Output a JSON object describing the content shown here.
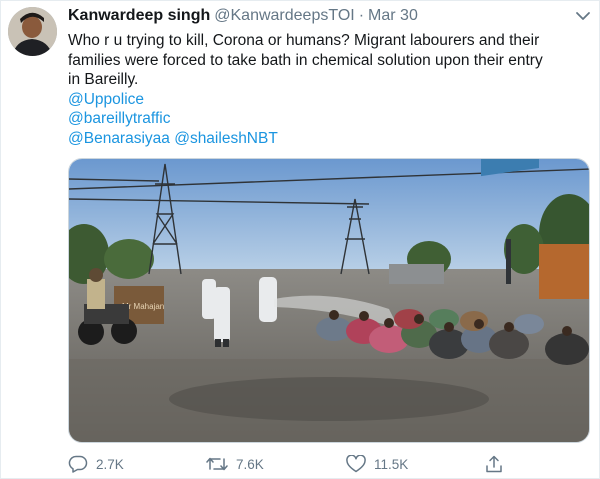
{
  "tweet": {
    "author": {
      "display_name": "Kanwardeep singh",
      "handle": "@KanwardeepsTOI"
    },
    "separator": "·",
    "date": "Mar 30",
    "body_lines": [
      "Who r u trying to kill, Corona or humans? Migrant labourers and their",
      "families were forced to take bath in chemical solution upon their entry",
      "in Bareilly."
    ],
    "mentions": [
      "@Uppolice",
      "@bareillytraffic",
      "@Benarasiyaa @shaileshNBT"
    ],
    "media": {
      "sign_text": "Mr Mahajan"
    },
    "stats": {
      "replies": "2.7K",
      "retweets": "7.6K",
      "likes": "11.5K"
    }
  },
  "icons": {
    "reply": "speech-bubble-icon",
    "retweet": "retweet-arrows-icon",
    "like": "heart-icon",
    "share": "share-upload-icon",
    "more": "chevron-down-icon"
  },
  "colors": {
    "link": "#1b95e0",
    "secondary_text": "#657786",
    "primary_text": "#14171a"
  }
}
